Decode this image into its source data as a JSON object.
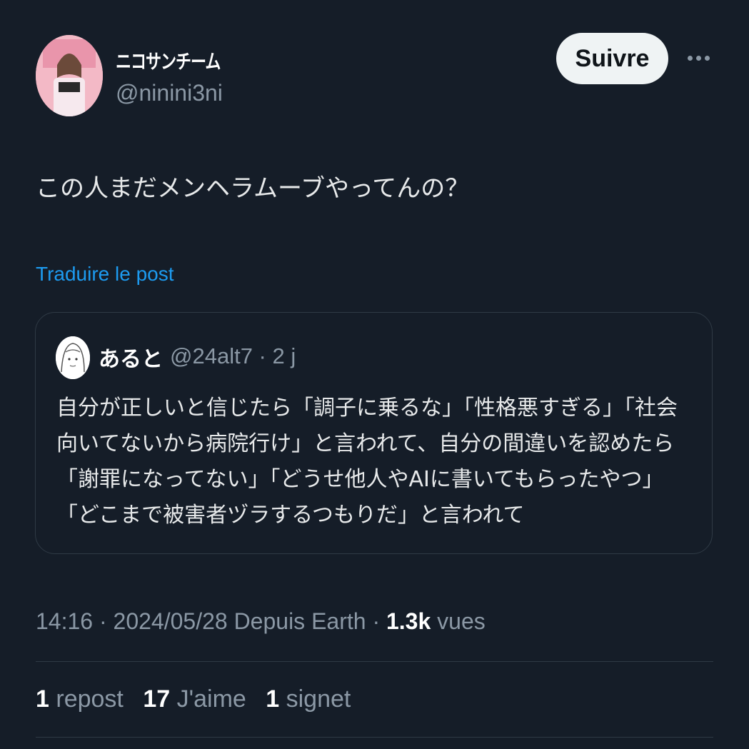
{
  "author": {
    "display_name": "ニコサンチーム",
    "handle": "@ninini3ni"
  },
  "header": {
    "follow_label": "Suivre"
  },
  "tweet": {
    "text": "この人まだメンヘラムーブやってんの？",
    "translate_label": "Traduire le post"
  },
  "quoted": {
    "name": "あると",
    "meta": "@24alt7 · 2 j",
    "lines": [
      "自分が正しいと信じたら「調子に乗るな」「性格悪すぎる」「社会",
      "向いてないから病院行け」と言われて、自分の間違いを認めたら",
      "「謝罪になってない」「どうせ他人やAIに書いてもらったやつ」",
      "「どこまで被害者ヅラするつもりだ」と言われて"
    ]
  },
  "footer": {
    "time": "14:16",
    "date": "2024/05/28",
    "source": "Depuis Earth",
    "views_count": "1.3k",
    "views_label": "vues"
  },
  "stats": {
    "reposts_count": "1",
    "reposts_label": "repost",
    "likes_count": "17",
    "likes_label": "J'aime",
    "bookmarks_count": "1",
    "bookmarks_label": "signet"
  },
  "colors": {
    "background": "#151d28",
    "link": "#1d9bf0",
    "muted": "#8b98a5",
    "button_bg": "#eff3f4"
  },
  "icons": [
    "avatar",
    "more-icon",
    "quote-avatar"
  ]
}
